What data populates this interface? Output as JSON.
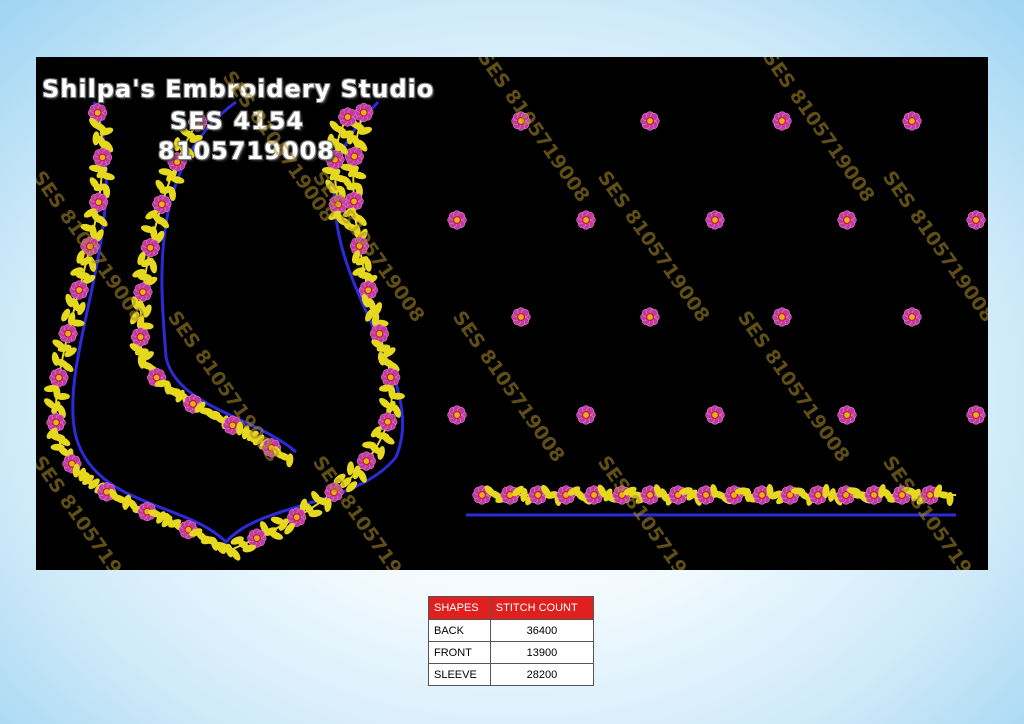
{
  "header": {
    "studio_name": "Shilpa's Embroidery Studio",
    "design_code": "SES  4154",
    "phone": "8105719008"
  },
  "watermark": "SES 8105719008",
  "colors": {
    "background_panel": "#000000",
    "outline": "#2b2bd9",
    "leaf": "#e6d81f",
    "petal": "#c23aa0",
    "center": "#e8b020",
    "table_header": "#e0201f"
  },
  "stitch_table": {
    "headers": [
      "SHAPES",
      "STITCH COUNT"
    ],
    "rows": [
      {
        "shape": "BACK",
        "count": "36400"
      },
      {
        "shape": "FRONT",
        "count": "13900"
      },
      {
        "shape": "SLEEVE",
        "count": "28200"
      }
    ]
  }
}
